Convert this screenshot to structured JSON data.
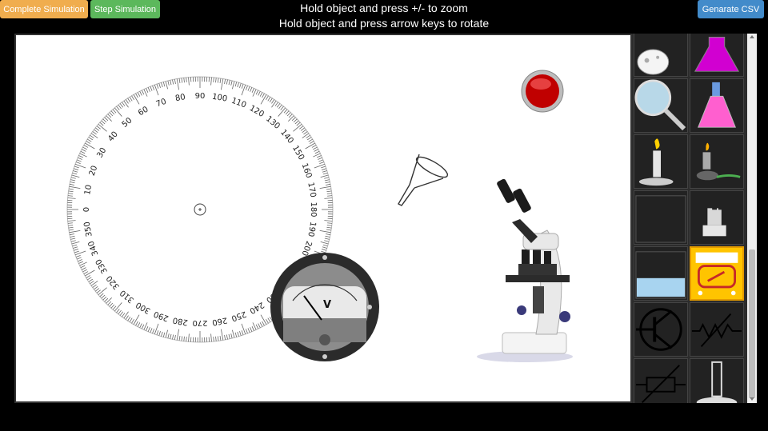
{
  "toolbar": {
    "complete_label": "Complete Simulation",
    "step_label": "Step Simulation",
    "csv_label": "Genarate CSV"
  },
  "instructions": {
    "line1": "Hold object and press +/- to zoom",
    "line2": "Hold object and press arrow keys to rotate"
  },
  "protractor": {
    "labels": [
      "0",
      "10",
      "20",
      "30",
      "40",
      "50",
      "60",
      "70",
      "80",
      "90",
      "100",
      "110",
      "120",
      "130",
      "140",
      "150",
      "160",
      "170",
      "180",
      "190",
      "200",
      "210",
      "220",
      "230",
      "240",
      "250",
      "260",
      "270",
      "280",
      "290",
      "300",
      "310",
      "320",
      "330",
      "340",
      "350"
    ]
  },
  "voltmeter": {
    "symbol": "V"
  },
  "palette": {
    "items": [
      "flask-icon",
      "magenta-flask-icon",
      "magnifier-icon",
      "conical-flask-icon",
      "bunsen-burner-icon",
      "spirit-lamp-icon",
      "empty-beaker-icon",
      "stereo-microscope-icon",
      "water-beaker-icon",
      "multimeter-icon",
      "transistor-icon",
      "variable-resistor-icon",
      "variable-resistor-box-icon",
      "graduated-cylinder-icon"
    ]
  },
  "colors": {
    "complete": "#f0ad4e",
    "step": "#5cb85c",
    "csv": "#428bca",
    "selected_tile": "#ffc400"
  }
}
